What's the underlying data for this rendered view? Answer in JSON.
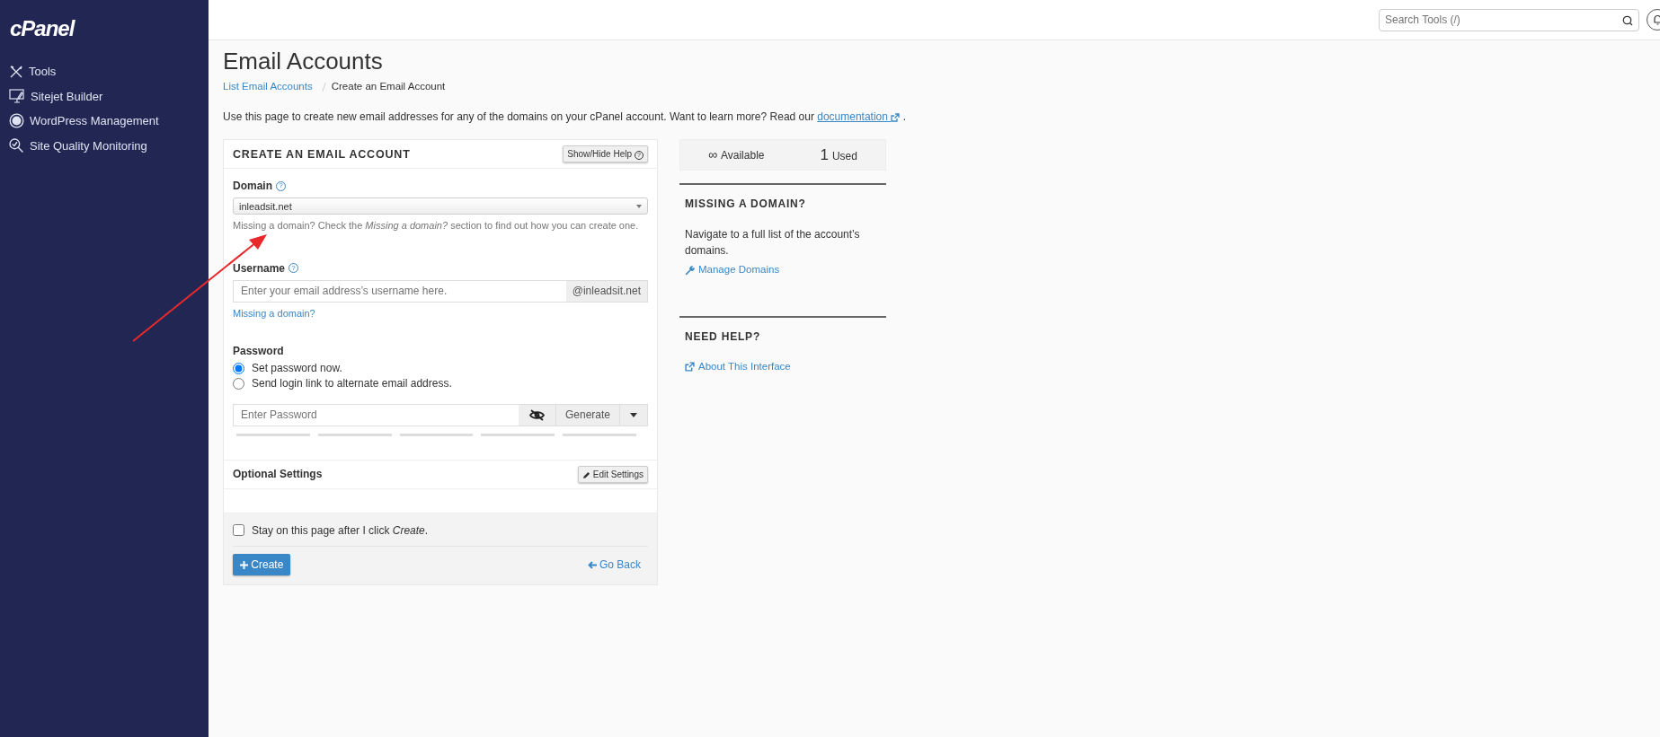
{
  "sidebar": {
    "logo": "cPanel",
    "items": [
      {
        "label": "Tools"
      },
      {
        "label": "Sitejet Builder"
      },
      {
        "label": "WordPress Management"
      },
      {
        "label": "Site Quality Monitoring"
      }
    ]
  },
  "header": {
    "search": {
      "placeholder": "Search Tools (/)"
    }
  },
  "page": {
    "title": "Email Accounts",
    "breadcrumb": [
      {
        "label": "List Email Accounts"
      },
      {
        "label": "Create an Email Account"
      }
    ],
    "intro": "Use this page to create new email addresses for any of the domains on your cPanel account. Want to learn more? Read our",
    "intro_link": "documentation",
    "intro_end": "."
  },
  "form": {
    "title": "CREATE AN EMAIL ACCOUNT",
    "help_button": "Show/Hide Help",
    "help_button_icon": "?",
    "domain": {
      "label": "Domain",
      "help_icon": "?",
      "value": "inleadsit.net",
      "hint": "Missing a domain? Check the *Missing a domain?* section to find out how you can create one."
    },
    "username": {
      "label": "Username",
      "help_icon": "?",
      "placeholder": "Enter your email address’s username here.",
      "suffix": "@inleadsit.net",
      "link": "Missing a domain?"
    },
    "password": {
      "label": "Password",
      "options": [
        {
          "label": "Set password now.",
          "selected": true
        },
        {
          "label": "Send login link to alternate email address.",
          "selected": false
        }
      ],
      "placeholder": "Enter Password",
      "generate": "Generate",
      "strength": {
        "level": 0
      }
    },
    "optional": {
      "title": "Optional Settings",
      "button": "Edit Settings"
    },
    "stay": {
      "label": "Stay on this page after I click *Create*.",
      "checked": false
    },
    "create": "Create",
    "back": "Go Back"
  },
  "stats": [
    {
      "value": "∞",
      "label": "Available"
    },
    {
      "value": "1",
      "label": "Used"
    }
  ],
  "side_sections": [
    {
      "title": "MISSING A DOMAIN?",
      "text": "Navigate to a full list of the account’s domains.",
      "link": "Manage Domains"
    },
    {
      "title": "NEED HELP?",
      "link": "About This Interface"
    }
  ]
}
